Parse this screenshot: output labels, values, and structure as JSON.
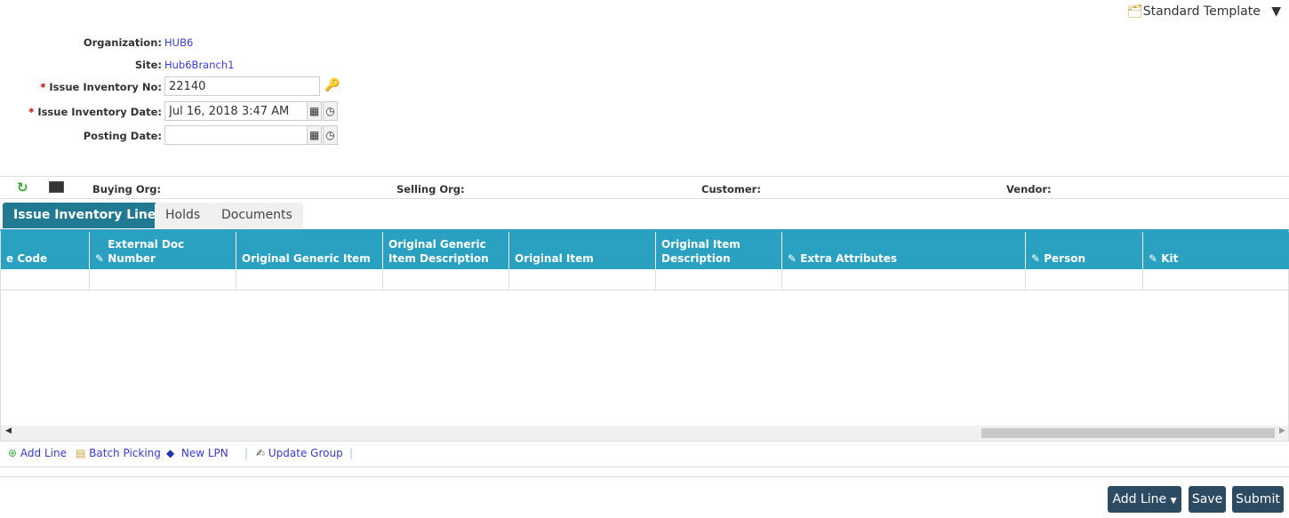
{
  "template": {
    "label": "Standard Template"
  },
  "form": {
    "organization_label": "Organization:",
    "organization": "HUB6",
    "site_label": "Site:",
    "site": "Hub6Branch1",
    "issue_no_label": "Issue Inventory No:",
    "issue_no": "22140",
    "issue_date_label": "Issue Inventory Date:",
    "issue_date": "Jul 16, 2018 3:47 AM",
    "posting_date_label": "Posting Date:",
    "posting_date": "",
    "required_mark": "*"
  },
  "infobar": {
    "buying_org": "Buying Org:",
    "selling_org": "Selling Org:",
    "customer": "Customer:",
    "vendor": "Vendor:"
  },
  "tabs": [
    {
      "label": "Issue Inventory Lines"
    },
    {
      "label": "Holds"
    },
    {
      "label": "Documents"
    }
  ],
  "grid": {
    "columns": [
      "e Code",
      "External Doc Number",
      "Original Generic Item",
      "Original Generic Item Description",
      "Original Item",
      "Original Item Description",
      "Extra Attributes",
      "Person",
      "Kit"
    ]
  },
  "toolbar": {
    "add_line": "Add Line",
    "batch_picking": "Batch Picking",
    "new_lpn": "New LPN",
    "update_group": "Update Group"
  },
  "footer": {
    "add_line": "Add Line",
    "save": "Save",
    "submit": "Submit"
  }
}
